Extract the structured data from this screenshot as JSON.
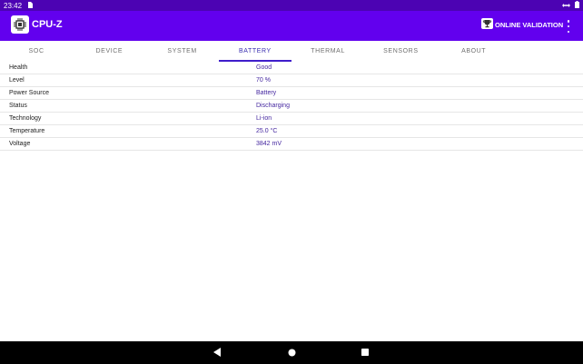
{
  "statusbar": {
    "time": "23:42"
  },
  "appbar": {
    "title": "CPU-Z",
    "validation_label": "ONLINE VALIDATION"
  },
  "tabs": [
    {
      "label": "SOC",
      "active": false
    },
    {
      "label": "DEVICE",
      "active": false
    },
    {
      "label": "SYSTEM",
      "active": false
    },
    {
      "label": "BATTERY",
      "active": true
    },
    {
      "label": "THERMAL",
      "active": false
    },
    {
      "label": "SENSORS",
      "active": false
    },
    {
      "label": "ABOUT",
      "active": false
    }
  ],
  "battery": [
    {
      "label": "Health",
      "value": "Good"
    },
    {
      "label": "Level",
      "value": "70 %"
    },
    {
      "label": "Power Source",
      "value": "Battery"
    },
    {
      "label": "Status",
      "value": "Discharging"
    },
    {
      "label": "Technology",
      "value": "Li-ion"
    },
    {
      "label": "Temperature",
      "value": "25.0 °C"
    },
    {
      "label": "Voltage",
      "value": "3842 mV"
    }
  ],
  "colors": {
    "appbar": "#6200ee",
    "statusbar": "#4c03b3",
    "accent": "#3f1dcb",
    "value_text": "#4527a0"
  }
}
